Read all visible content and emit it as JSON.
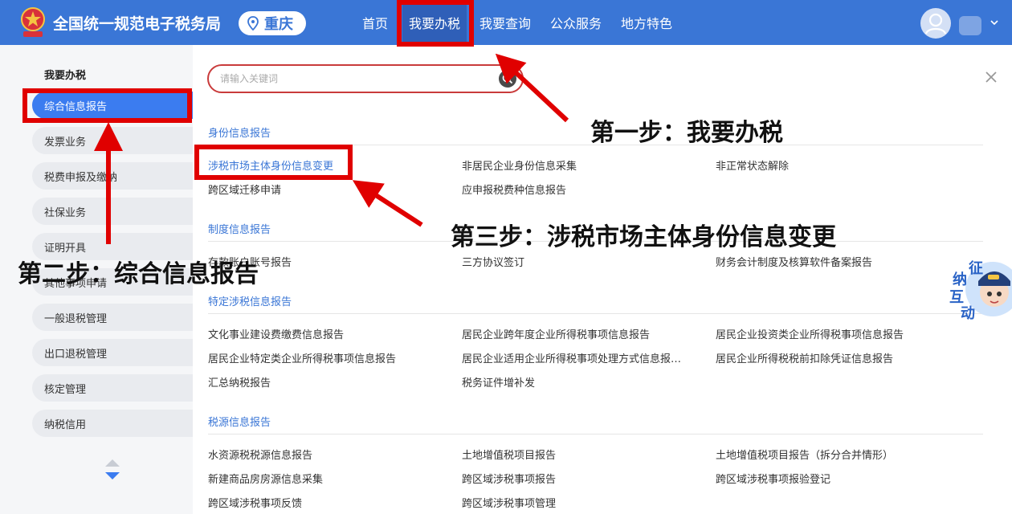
{
  "header": {
    "site_title": "全国统一规范电子税务局",
    "region": "重庆",
    "nav": [
      "首页",
      "我要办税",
      "我要查询",
      "公众服务",
      "地方特色"
    ]
  },
  "sidebar": {
    "title": "我要办税",
    "items": [
      "综合信息报告",
      "发票业务",
      "税费申报及缴纳",
      "社保业务",
      "证明开具",
      "其他事项申请",
      "一般退税管理",
      "出口退税管理",
      "核定管理",
      "纳税信用"
    ]
  },
  "search": {
    "placeholder": "请输入关键词"
  },
  "sections": [
    {
      "title": "身份信息报告",
      "links": [
        "涉税市场主体身份信息变更",
        "非居民企业身份信息采集",
        "非正常状态解除",
        "跨区域迁移申请",
        "应申报税费种信息报告"
      ]
    },
    {
      "title": "制度信息报告",
      "links": [
        "存款账户账号报告",
        "三方协议签订",
        "财务会计制度及核算软件备案报告"
      ]
    },
    {
      "title": "特定涉税信息报告",
      "links": [
        "文化事业建设费缴费信息报告",
        "居民企业跨年度企业所得税事项信息报告",
        "居民企业投资类企业所得税事项信息报告",
        "居民企业特定类企业所得税事项信息报告",
        "居民企业适用企业所得税事项处理方式信息报…",
        "居民企业所得税税前扣除凭证信息报告",
        "汇总纳税报告",
        "税务证件增补发"
      ]
    },
    {
      "title": "税源信息报告",
      "links": [
        "水资源税税源信息报告",
        "土地增值税项目报告",
        "土地增值税项目报告（拆分合并情形）",
        "新建商品房房源信息采集",
        "跨区域涉税事项报告",
        "跨区域涉税事项报验登记",
        "跨区域涉税事项反馈",
        "跨区域涉税事项管理"
      ]
    }
  ],
  "badge": {
    "chars": [
      "征",
      "纳",
      "互",
      "动"
    ]
  },
  "annotations": {
    "step1": "第一步：我要办税",
    "step2": "第二步：综合信息报告",
    "step3": "第三步：涉税市场主体身份信息变更"
  },
  "colors": {
    "header_bg": "#3a76d6",
    "accent": "#3b7cf0",
    "annotation_red": "#e00000",
    "section_title": "#3a76d6"
  }
}
